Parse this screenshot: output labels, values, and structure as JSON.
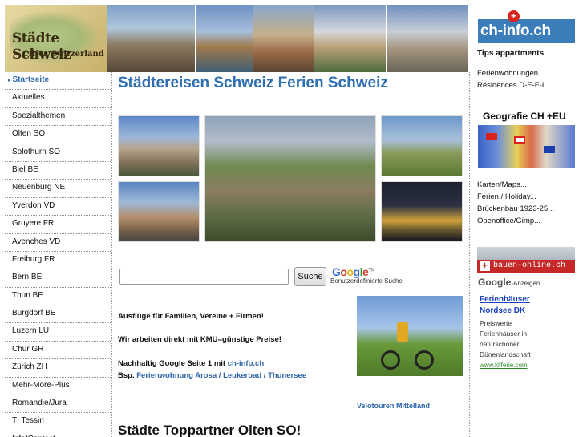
{
  "header": {
    "logo_title": "Städte Schweiz",
    "logo_subtitle": "Cities Switzerland"
  },
  "nav": {
    "items": [
      {
        "label": "Startseite",
        "active": true
      },
      {
        "label": "Aktuelles"
      },
      {
        "label": "Spezialthemen"
      },
      {
        "label": "Olten SO"
      },
      {
        "label": "Solothurn SO"
      },
      {
        "label": "Biel BE"
      },
      {
        "label": "Neuenburg NE"
      },
      {
        "label": "Yverdon VD"
      },
      {
        "label": "Gruyere FR"
      },
      {
        "label": "Avenches VD"
      },
      {
        "label": "Freiburg FR"
      },
      {
        "label": "Bern BE"
      },
      {
        "label": "Thun BE"
      },
      {
        "label": "Burgdorf BE"
      },
      {
        "label": "Luzern LU"
      },
      {
        "label": "Chur GR"
      },
      {
        "label": "Zürich ZH"
      },
      {
        "label": "Mehr-More-Plus"
      },
      {
        "label": "Romandie/Jura"
      },
      {
        "label": "TI Tessin"
      },
      {
        "label": "Info/Contact"
      }
    ]
  },
  "main": {
    "title": "Städtereisen Schweiz Ferien Schweiz",
    "search": {
      "placeholder": "",
      "button_label": "Suche",
      "google_logo": [
        "G",
        "o",
        "o",
        "g",
        "l",
        "e"
      ],
      "google_sub": "Benutzerdefinierte Suche"
    },
    "p1": "Ausflüge für Familien, Vereine + Firmen!",
    "p2": "Wir arbeiten direkt mit KMU=günstige Preise!",
    "p3_text": "Nachhaltig Google Seite 1 mit ",
    "p3_link": "ch-info.ch",
    "p4_text": "Bsp. ",
    "p4_link1": "Ferienwohnung Arosa",
    "p4_sep1": " / ",
    "p4_link2": "Leukerbad",
    "p4_sep2": " / ",
    "p4_link3": "Thunersee",
    "bike_caption": "Velotouren Mittelland",
    "section_title": "Städte Toppartner Olten SO!"
  },
  "right": {
    "chinfo_logo": "ch-info.ch",
    "tips_title": "Tips appartments",
    "links_a": [
      "Ferienwohnungen",
      "Résidences D-E-F-I ..."
    ],
    "geo_title": "Geografie CH +EU",
    "links_b": [
      "Karten/Maps...",
      "Ferien / Holiday...",
      "Brückenbau 1923-25...",
      "Openoffice/Gimp..."
    ],
    "bauen_label": "bauen-online.ch",
    "gads_logo": "Google",
    "gads_suffix": "-Anzeigen",
    "ad": {
      "title_line1": "Ferienhäuser",
      "title_line2": "Nordsee DK",
      "text": [
        "Preiswerte",
        "Ferienhäuser in",
        "naturschöner",
        "Dünenlandschaft"
      ],
      "url": "www.kliferie.com"
    }
  },
  "colors": {
    "link_blue": "#2d66a8",
    "title_blue": "#2f6fb3",
    "ad_blue": "#1a3fc0",
    "ad_green": "#2a8a2a"
  }
}
